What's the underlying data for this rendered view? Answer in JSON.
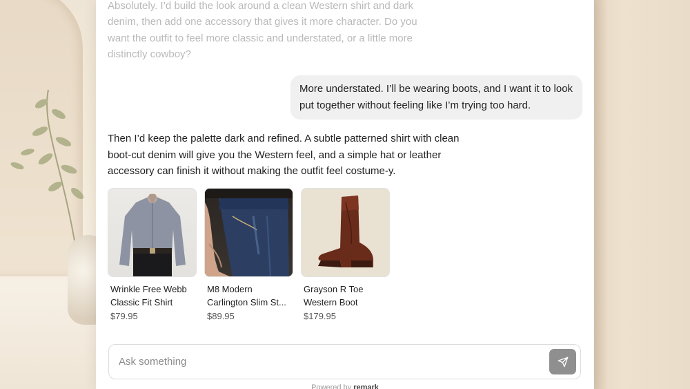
{
  "conversation": {
    "previous_assistant": "Absolutely. I’d build the look around a clean Western shirt and dark denim, then add one accessory that gives it more character. Do you want the outfit to feel more classic and understated, or a little more distinctly cowboy?",
    "user_message": "More understated. I’ll be wearing boots, and I want it to look put together without feeling like I’m trying too hard.",
    "assistant_message": "Then I’d keep the palette dark and refined. A subtle patterned shirt with clean boot-cut denim will give you the Western feel, and a simple hat or leather accessory can finish it without making the outfit feel costume-y."
  },
  "products": [
    {
      "title_line1": "Wrinkle Free Webb",
      "title_line2": "Classic Fit Shirt",
      "price": "$79.95",
      "icon": "shirt-photo"
    },
    {
      "title_line1": "M8 Modern",
      "title_line2": "Carlington Slim St...",
      "price": "$89.95",
      "icon": "jeans-photo"
    },
    {
      "title_line1": "Grayson R Toe",
      "title_line2": "Western Boot",
      "price": "$179.95",
      "icon": "boot-photo"
    }
  ],
  "composer": {
    "placeholder": "Ask something",
    "send_icon": "send-icon"
  },
  "footer": {
    "powered_by": "Powered by",
    "brand": "remark"
  }
}
